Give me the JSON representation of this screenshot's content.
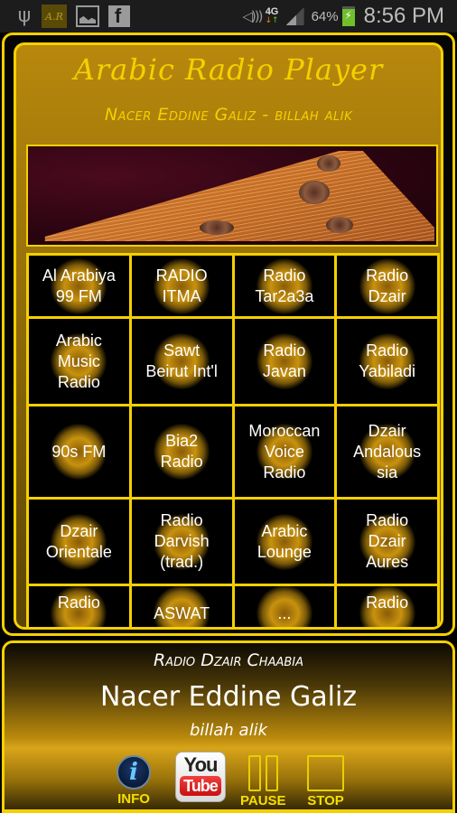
{
  "status_bar": {
    "icons": [
      "usb-icon",
      "arabic-radio-app-icon",
      "gallery-icon",
      "facebook-icon",
      "wifi-hotspot-icon",
      "4g-lte-icon",
      "signal-icon",
      "battery-charging-icon"
    ],
    "app_icon_text": "A.R",
    "facebook_glyph": "f",
    "network_label": "4G",
    "battery_percent": "64%",
    "time": "8:56 PM"
  },
  "header": {
    "title": "Arabic Radio Player",
    "now_playing_line": "Nacer Eddine Galiz - billah alik"
  },
  "banner": {
    "image": "kanun-instrument-photo"
  },
  "stations": [
    [
      "Al Arabiya",
      "99 FM"
    ],
    [
      "RADIO",
      "ITMA"
    ],
    [
      "Radio",
      "Tar2a3a"
    ],
    [
      "Radio",
      "Dzair"
    ],
    [
      "Arabic",
      "Music",
      "Radio"
    ],
    [
      "Sawt",
      "Beirut Int'l"
    ],
    [
      "Radio",
      "Javan"
    ],
    [
      "Radio",
      "Yabiladi"
    ],
    [
      "90s FM"
    ],
    [
      "Bia2",
      "Radio"
    ],
    [
      "Moroccan",
      "Voice",
      "Radio"
    ],
    [
      "Dzair",
      "Andalous",
      "sia"
    ],
    [
      "Dzair",
      "Orientale"
    ],
    [
      "Radio",
      "Darvish",
      "(trad.)"
    ],
    [
      "Arabic",
      "Lounge"
    ],
    [
      "Radio",
      "Dzair",
      "Aures"
    ],
    [
      "Radio",
      "..."
    ],
    [
      "ASWAT"
    ],
    [
      "..."
    ],
    [
      "Radio",
      "..."
    ]
  ],
  "player": {
    "station": "Radio Dzair Chaabia",
    "artist": "Nacer Eddine Galiz",
    "song": "billah alik",
    "controls": {
      "info_label": "INFO",
      "youtube_you": "You",
      "youtube_tube": "Tube",
      "pause_label": "PAUSE",
      "stop_label": "STOP"
    }
  },
  "colors": {
    "accent_yellow": "#f5d000",
    "panel_gold": "#b8880c",
    "background": "#000000"
  }
}
